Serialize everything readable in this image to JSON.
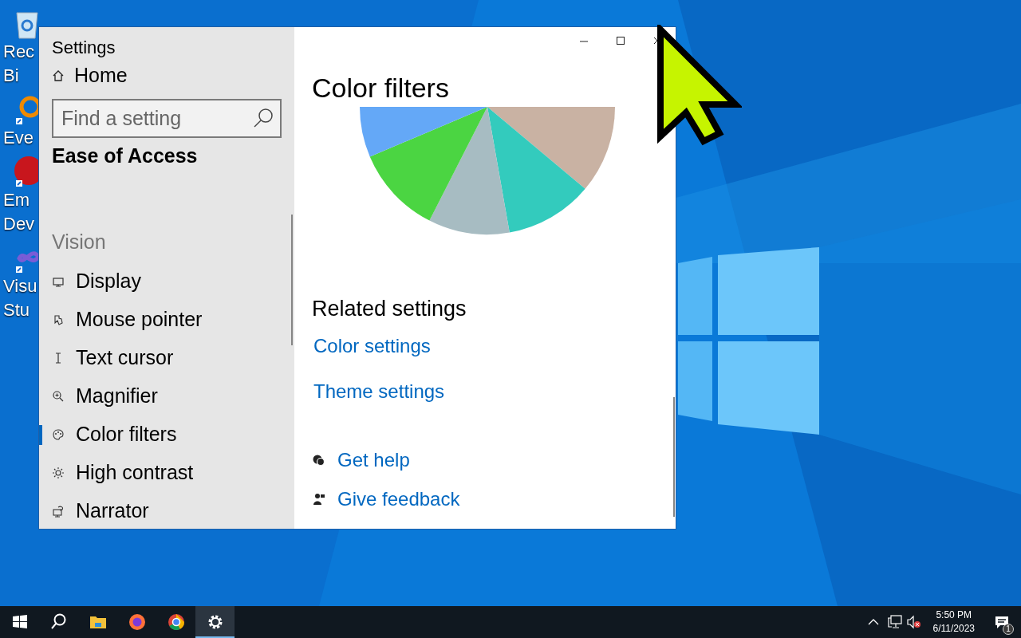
{
  "desktop_icons": [
    {
      "kind": "recycle",
      "lines": [
        "Rec",
        "Bi"
      ]
    },
    {
      "kind": "search-app",
      "lines": [
        "Eve"
      ]
    },
    {
      "kind": "devcpp",
      "lines": [
        "Em",
        "Dev"
      ]
    },
    {
      "kind": "vstudio",
      "lines": [
        "Visu",
        "Stu"
      ]
    }
  ],
  "window": {
    "title": "Settings",
    "home": "Home",
    "search": {
      "placeholder": "Find a setting"
    },
    "section": "Ease of Access",
    "group": "Vision",
    "nav_items": [
      {
        "kind": "display",
        "label": "Display",
        "selected": false
      },
      {
        "kind": "pointer",
        "label": "Mouse pointer",
        "selected": false
      },
      {
        "kind": "cursor",
        "label": "Text cursor",
        "selected": false
      },
      {
        "kind": "magnifier",
        "label": "Magnifier",
        "selected": false
      },
      {
        "kind": "palette",
        "label": "Color filters",
        "selected": true
      },
      {
        "kind": "contrast",
        "label": "High contrast",
        "selected": false
      },
      {
        "kind": "narrator",
        "label": "Narrator",
        "selected": false
      }
    ],
    "heading": "Color filters",
    "related": {
      "title": "Related settings",
      "links": [
        "Color settings",
        "Theme settings"
      ]
    },
    "help_links": [
      {
        "kind": "help",
        "label": "Get help"
      },
      {
        "kind": "feedback",
        "label": "Give feedback"
      }
    ]
  },
  "taskbar": {
    "apps": [
      {
        "kind": "start",
        "active": false
      },
      {
        "kind": "search",
        "active": false
      },
      {
        "kind": "explorer",
        "active": false
      },
      {
        "kind": "firefox",
        "active": false
      },
      {
        "kind": "chrome",
        "active": false
      },
      {
        "kind": "settings",
        "active": true
      }
    ],
    "time": "5:50 PM",
    "date": "6/11/2023",
    "notifications": "1"
  }
}
